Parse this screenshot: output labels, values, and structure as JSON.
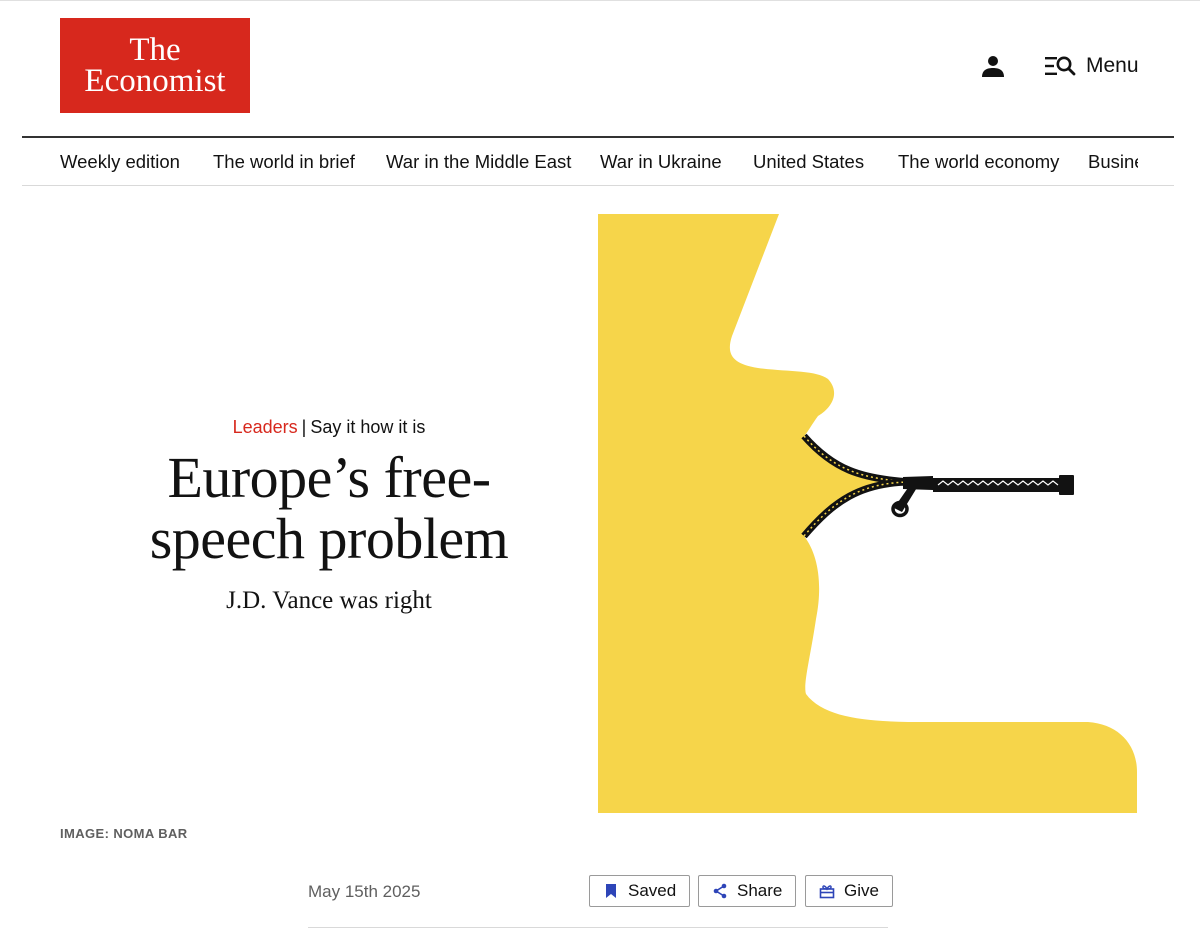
{
  "header": {
    "logo": {
      "line1": "The",
      "line2": "Economist"
    },
    "menu_label": "Menu",
    "icons": {
      "account": "person-icon",
      "menu": "menu-search-icon"
    }
  },
  "nav": {
    "items": [
      "Weekly edition",
      "The world in brief",
      "War in the Middle East",
      "War in Ukraine",
      "United States",
      "The world economy",
      "Busine"
    ]
  },
  "article": {
    "section": "Leaders",
    "separator": "|",
    "flytitle": "Say it how it is",
    "headline_line1": "Europe’s free-",
    "headline_line2": "speech problem",
    "subheadline": "J.D. Vance was right",
    "image_credit": "IMAGE: NOMA BAR",
    "date": "May 15th 2025"
  },
  "actions": {
    "saved": "Saved",
    "share": "Share",
    "give": "Give",
    "icons": {
      "saved": "bookmark-icon",
      "share": "share-icon",
      "give": "gift-icon"
    }
  },
  "colors": {
    "brand_red": "#d7281d",
    "illustration_yellow": "#f6d54a",
    "action_icon_blue": "#2e45b8",
    "text": "#121212",
    "muted_text": "#5f5f5f"
  }
}
